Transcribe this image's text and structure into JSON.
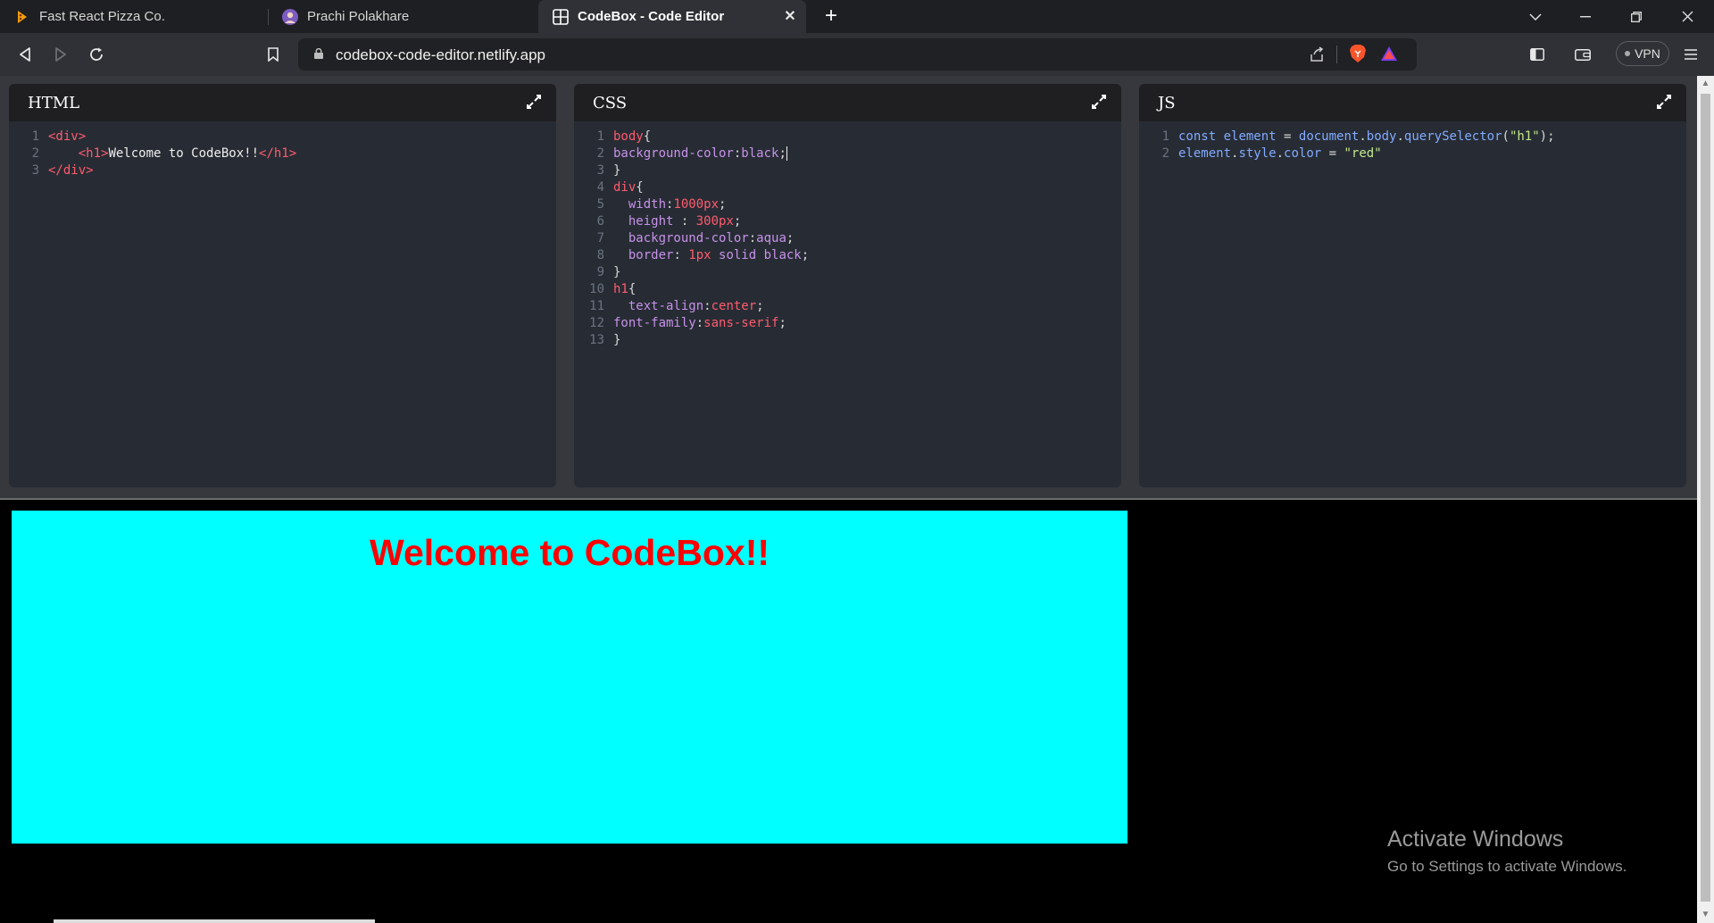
{
  "browser": {
    "tabs": [
      {
        "title": "Fast React Pizza Co.",
        "icon": "pizza-icon"
      },
      {
        "title": "Prachi Polakhare",
        "icon": "avatar-icon"
      },
      {
        "title": "CodeBox - Code Editor",
        "icon": "codebox-icon",
        "active": true
      }
    ],
    "url": "codebox-code-editor.netlify.app",
    "vpn_label": "VPN"
  },
  "editors": {
    "html": {
      "title": "HTML",
      "lines": [
        [
          {
            "t": "tag",
            "v": "<div>"
          }
        ],
        [
          {
            "t": "txt",
            "v": "    "
          },
          {
            "t": "tag",
            "v": "<h1>"
          },
          {
            "t": "txt",
            "v": "Welcome to CodeBox!!"
          },
          {
            "t": "tag",
            "v": "</h1>"
          }
        ],
        [
          {
            "t": "tag",
            "v": "</div>"
          }
        ]
      ]
    },
    "css": {
      "title": "CSS",
      "lines": [
        [
          {
            "t": "sel",
            "v": "body"
          },
          {
            "t": "punc",
            "v": "{"
          }
        ],
        [
          {
            "t": "prop",
            "v": "background-color"
          },
          {
            "t": "punc",
            "v": ":"
          },
          {
            "t": "prop",
            "v": "black"
          },
          {
            "t": "punc",
            "v": ";"
          },
          {
            "t": "cursor",
            "v": ""
          }
        ],
        [
          {
            "t": "punc",
            "v": "}"
          }
        ],
        [
          {
            "t": "sel",
            "v": "div"
          },
          {
            "t": "punc",
            "v": "{"
          }
        ],
        [
          {
            "t": "txt",
            "v": "  "
          },
          {
            "t": "prop",
            "v": "width"
          },
          {
            "t": "punc",
            "v": ":"
          },
          {
            "t": "val",
            "v": "1000px"
          },
          {
            "t": "punc",
            "v": ";"
          }
        ],
        [
          {
            "t": "txt",
            "v": "  "
          },
          {
            "t": "prop",
            "v": "height"
          },
          {
            "t": "punc",
            "v": " : "
          },
          {
            "t": "val",
            "v": "300px"
          },
          {
            "t": "punc",
            "v": ";"
          }
        ],
        [
          {
            "t": "txt",
            "v": "  "
          },
          {
            "t": "prop",
            "v": "background-color"
          },
          {
            "t": "punc",
            "v": ":"
          },
          {
            "t": "prop",
            "v": "aqua"
          },
          {
            "t": "punc",
            "v": ";"
          }
        ],
        [
          {
            "t": "txt",
            "v": "  "
          },
          {
            "t": "prop",
            "v": "border"
          },
          {
            "t": "punc",
            "v": ": "
          },
          {
            "t": "val",
            "v": "1px"
          },
          {
            "t": "prop",
            "v": " solid black"
          },
          {
            "t": "punc",
            "v": ";"
          }
        ],
        [
          {
            "t": "punc",
            "v": "}"
          }
        ],
        [
          {
            "t": "sel",
            "v": "h1"
          },
          {
            "t": "punc",
            "v": "{"
          }
        ],
        [
          {
            "t": "txt",
            "v": "  "
          },
          {
            "t": "prop",
            "v": "text-align"
          },
          {
            "t": "punc",
            "v": ":"
          },
          {
            "t": "val",
            "v": "center"
          },
          {
            "t": "punc",
            "v": ";"
          }
        ],
        [
          {
            "t": "prop",
            "v": "font-family"
          },
          {
            "t": "punc",
            "v": ":"
          },
          {
            "t": "val",
            "v": "sans-serif"
          },
          {
            "t": "punc",
            "v": ";"
          }
        ],
        [
          {
            "t": "punc",
            "v": "}"
          }
        ]
      ]
    },
    "js": {
      "title": "JS",
      "lines": [
        [
          {
            "t": "kw",
            "v": "const"
          },
          {
            "t": "var",
            "v": " element"
          },
          {
            "t": "punc",
            "v": " = "
          },
          {
            "t": "var",
            "v": "document"
          },
          {
            "t": "punc",
            "v": "."
          },
          {
            "t": "var",
            "v": "body"
          },
          {
            "t": "punc",
            "v": "."
          },
          {
            "t": "var",
            "v": "querySelector"
          },
          {
            "t": "punc",
            "v": "("
          },
          {
            "t": "str",
            "v": "\"h1\""
          },
          {
            "t": "punc",
            "v": ");"
          }
        ],
        [
          {
            "t": "var",
            "v": "element"
          },
          {
            "t": "punc",
            "v": "."
          },
          {
            "t": "var",
            "v": "style"
          },
          {
            "t": "punc",
            "v": "."
          },
          {
            "t": "var",
            "v": "color"
          },
          {
            "t": "punc",
            "v": " = "
          },
          {
            "t": "str",
            "v": "\"red\""
          }
        ]
      ]
    }
  },
  "preview": {
    "heading": "Welcome to CodeBox!!",
    "box_color": "#00ffff",
    "heading_color": "#ff0000",
    "background": "#000000"
  },
  "watermark": {
    "line1": "Activate Windows",
    "line2": "Go to Settings to activate Windows."
  }
}
